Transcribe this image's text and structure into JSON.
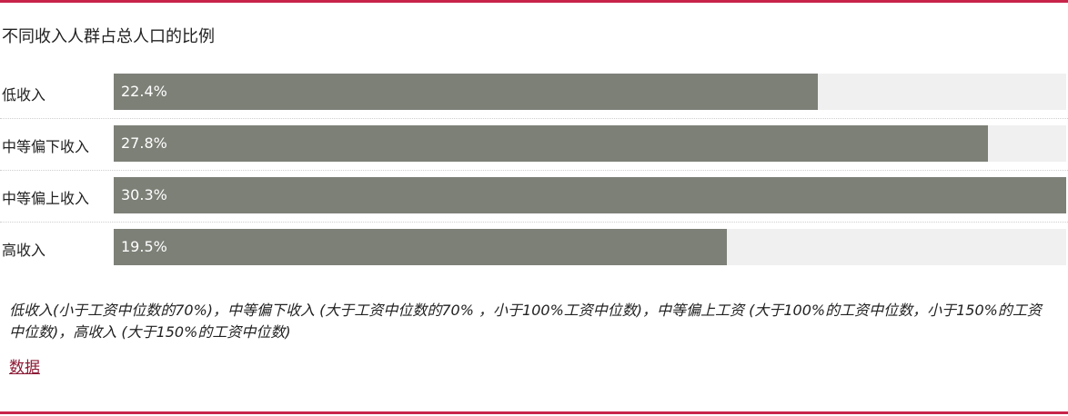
{
  "chart_data": {
    "type": "bar",
    "orientation": "horizontal",
    "title": "不同收入人群占总人口的比例",
    "categories": [
      "低收入",
      "中等偏下收入",
      "中等偏上收入",
      "高收入"
    ],
    "values": [
      22.4,
      27.8,
      30.3,
      19.5
    ],
    "value_labels": [
      "22.4%",
      "27.8%",
      "30.3%",
      "19.5%"
    ],
    "unit": "%",
    "xlim": [
      0,
      30.3
    ],
    "grid": false,
    "bar_color": "#7d8077",
    "track_color": "#f0f0f0"
  },
  "footnote": "低收入(小于工资中位数的70%)，中等偏下收入 (大于工资中位数的70% ，小于100%工资中位数)，中等偏上工资 (大于100%的工资中位数，小于150%的工资中位数)，高收入 (大于150%的工资中位数)",
  "source_link": "数据",
  "colors": {
    "accent_rule": "#c8244a",
    "link": "#8c1a35"
  }
}
